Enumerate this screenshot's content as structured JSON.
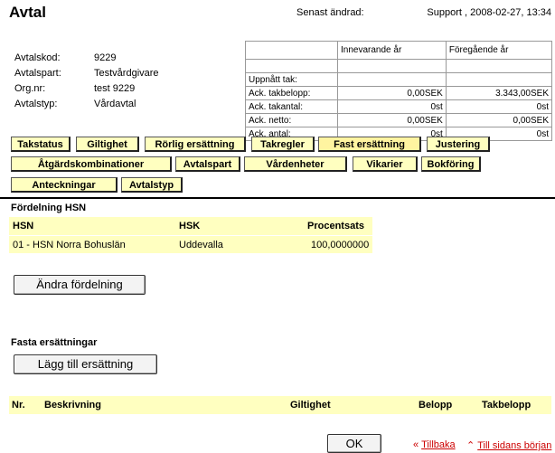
{
  "header": {
    "title": "Avtal",
    "changed_label": "Senast ändrad:",
    "changed_value": "Support , 2008-02-27, 13:34"
  },
  "info": [
    {
      "key": "Avtalskod:",
      "value": "9229"
    },
    {
      "key": "Avtalspart:",
      "value": "Testvårdgivare"
    },
    {
      "key": "Org.nr:",
      "value": "test 9229"
    },
    {
      "key": "Avtalstyp:",
      "value": "Vårdavtal"
    }
  ],
  "stats": {
    "headers": [
      "",
      "Innevarande år",
      "Föregående år"
    ],
    "rows": [
      [
        "Uppnått tak:",
        "",
        ""
      ],
      [
        "Ack. takbelopp:",
        "0,00SEK",
        "3.343,00SEK"
      ],
      [
        "Ack. takantal:",
        "0st",
        "0st"
      ],
      [
        "Ack. netto:",
        "0,00SEK",
        "0,00SEK"
      ],
      [
        "Ack. antal:",
        "0st",
        "0st"
      ]
    ]
  },
  "tabs": [
    {
      "label": "Takstatus"
    },
    {
      "label": "Giltighet"
    },
    {
      "label": "Rörlig ersättning"
    },
    {
      "label": "Takregler"
    },
    {
      "label": "Fast ersättning"
    },
    {
      "label": "Justering"
    },
    {
      "label": "Åtgärdskombinationer"
    },
    {
      "label": "Avtalspart"
    },
    {
      "label": "Vårdenheter"
    },
    {
      "label": "Vikarier"
    },
    {
      "label": "Bokföring"
    },
    {
      "label": "Anteckningar"
    },
    {
      "label": "Avtalstyp"
    }
  ],
  "distribution": {
    "title": "Fördelning HSN",
    "columns": [
      "HSN",
      "HSK",
      "Procentsats"
    ],
    "row": [
      "01 - HSN Norra Bohuslän",
      "Uddevalla",
      "100,0000000"
    ],
    "button": "Ändra fördelning"
  },
  "fixed": {
    "title": "Fasta ersättningar",
    "button": "Lägg till ersättning",
    "columns": [
      "Nr.",
      "Beskrivning",
      "Giltighet",
      "Belopp",
      "Takbelopp"
    ]
  },
  "footer": {
    "ok": "OK",
    "back": "Tillbaka",
    "top": "Till sidans början",
    "link_color": "#cc0000"
  }
}
